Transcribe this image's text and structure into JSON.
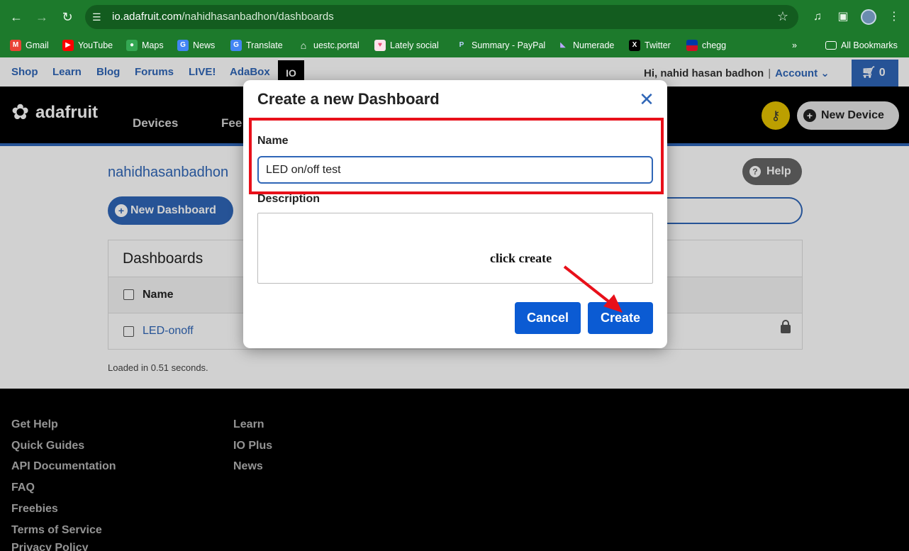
{
  "browser": {
    "url_host": "io.adafruit.com",
    "url_path": "/nahidhasanbadhon/dashboards",
    "bookmarks": [
      {
        "label": "Gmail",
        "icon": "gmail-icon",
        "color": "#ea4335"
      },
      {
        "label": "YouTube",
        "icon": "youtube-icon",
        "color": "#ff0000"
      },
      {
        "label": "Maps",
        "icon": "maps-icon",
        "color": "#34a853"
      },
      {
        "label": "News",
        "icon": "news-icon",
        "color": "#4285f4"
      },
      {
        "label": "Translate",
        "icon": "translate-icon",
        "color": "#4285f4"
      },
      {
        "label": "uestc.portal",
        "icon": "home-icon",
        "color": "#dddddd"
      },
      {
        "label": "Lately social",
        "icon": "lately-icon",
        "color": "#e94e77"
      },
      {
        "label": "Summary - PayPal",
        "icon": "paypal-icon",
        "color": "#003087"
      },
      {
        "label": "Numerade",
        "icon": "numerade-icon",
        "color": "#7b61ff"
      },
      {
        "label": "Twitter",
        "icon": "x-icon",
        "color": "#000000"
      },
      {
        "label": "chegg",
        "icon": "flag-icon",
        "color": "#0038a8"
      }
    ],
    "all_bookmarks": "All Bookmarks",
    "overflow": "»"
  },
  "topnav": {
    "links": [
      "Shop",
      "Learn",
      "Blog",
      "Forums",
      "LIVE!",
      "AdaBox"
    ],
    "io_tab": "IO",
    "greeting": "Hi, nahid hasan badhon",
    "separator": "|",
    "account": "Account",
    "cart_count": "0"
  },
  "mainbar": {
    "logo": "adafruit",
    "nav": [
      "Devices",
      "Fee"
    ],
    "new_device": "New Device"
  },
  "content": {
    "breadcrumb": "nahidhasanbadhon",
    "help": "Help",
    "new_dashboard": "New Dashboard",
    "table_title": "Dashboards",
    "column_name": "Name",
    "rows": [
      "LED-onoff"
    ],
    "loaded": "Loaded in 0.51 seconds."
  },
  "footer": {
    "col1": [
      "Get Help",
      "Quick Guides",
      "API Documentation",
      "FAQ",
      "Freebies",
      "Terms of Service",
      "Privacy Policy"
    ],
    "col2": [
      "Learn",
      "IO Plus",
      "News"
    ]
  },
  "modal": {
    "title": "Create a new Dashboard",
    "name_label": "Name",
    "name_value": "LED on/off test",
    "description_label": "Description",
    "description_value": "",
    "cancel": "Cancel",
    "create": "Create"
  },
  "annotation": {
    "text": "click create",
    "color": "#e8101a"
  }
}
